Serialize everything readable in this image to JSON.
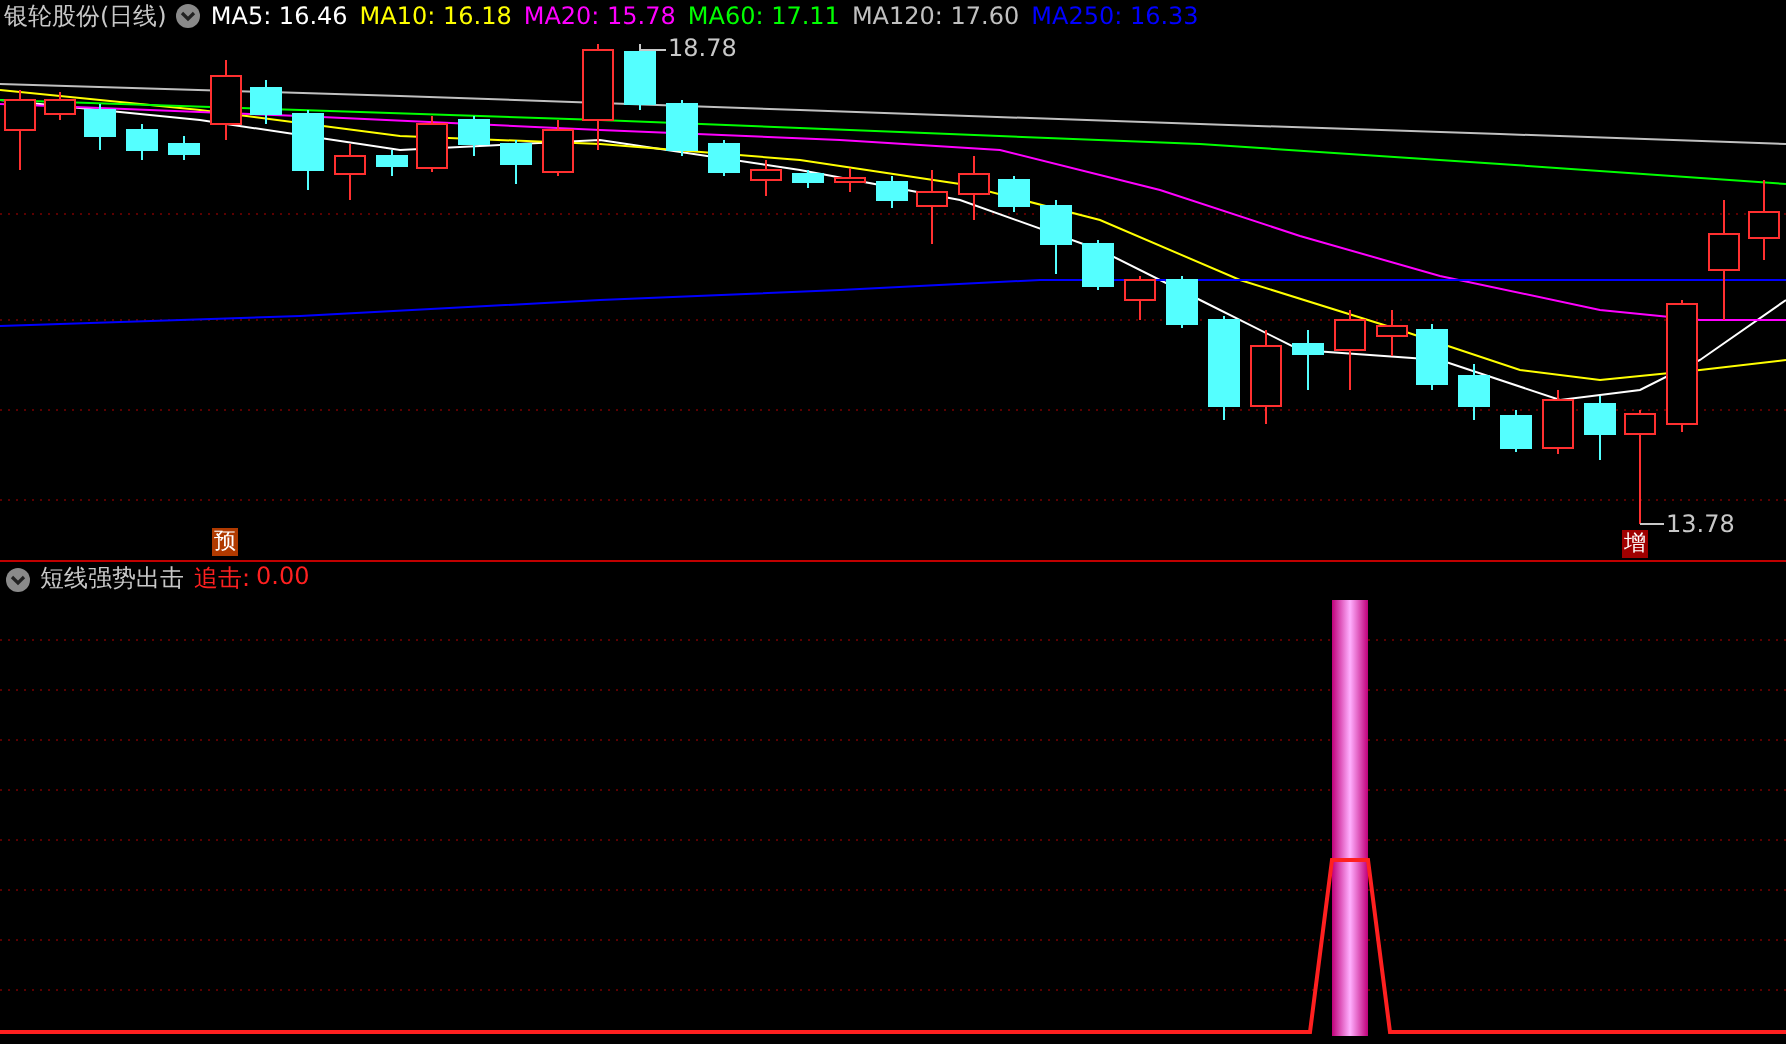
{
  "main_pane": {
    "title": "银轮股份(日线)",
    "moving_averages": [
      {
        "label": "MA5:",
        "value": "16.46",
        "color": "#ffffff"
      },
      {
        "label": "MA10:",
        "value": "16.18",
        "color": "#ffff00"
      },
      {
        "label": "MA20:",
        "value": "15.78",
        "color": "#ff00ff"
      },
      {
        "label": "MA60:",
        "value": "17.11",
        "color": "#00ff00"
      },
      {
        "label": "MA120:",
        "value": "17.60",
        "color": "#c0c0c0"
      },
      {
        "label": "MA250:",
        "value": "16.33",
        "color": "#0000ff"
      }
    ],
    "high_marker": "18.78",
    "low_marker": "13.78",
    "badges": [
      {
        "text": "预",
        "color": "#b03a00"
      },
      {
        "text": "增",
        "color": "#a00000"
      }
    ]
  },
  "indicator_pane": {
    "title": "短线强势出击",
    "reading_label": "追击:",
    "reading_value": "0.00"
  }
}
